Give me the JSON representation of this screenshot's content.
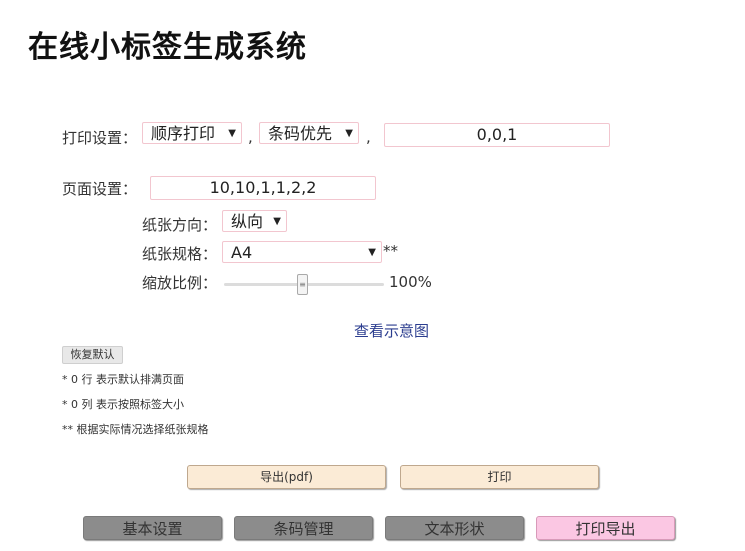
{
  "title": "在线小标签生成系统",
  "print_settings": {
    "label": "打印设置：",
    "order_select": "顺序打印",
    "priority_select": "条码优先",
    "separator": ",",
    "value": "0,0,1"
  },
  "page_settings": {
    "label": "页面设置：",
    "value": "10,10,1,1,2,2",
    "orientation_label": "纸张方向：",
    "orientation_value": "纵向",
    "paper_label": "纸张规格：",
    "paper_value": "A4",
    "paper_note": "**",
    "scale_label": "缩放比例：",
    "scale_value": "100%",
    "scale_level": 0.5
  },
  "preview_link": "查看示意图",
  "reset_button": "恢复默认",
  "notes": [
    "* 0 行 表示默认排满页面",
    "* 0 列 表示按照标签大小",
    "** 根据实际情况选择纸张规格"
  ],
  "actions": {
    "export_label": "导出(pdf)",
    "print_label": "打印"
  },
  "nav": [
    {
      "label": "基本设置",
      "color": "#8c8c8c"
    },
    {
      "label": "条码管理",
      "color": "#8c8c8c"
    },
    {
      "label": "文本形状",
      "color": "#8c8c8c"
    },
    {
      "label": "打印导出",
      "color": "#fbc7e3"
    }
  ]
}
